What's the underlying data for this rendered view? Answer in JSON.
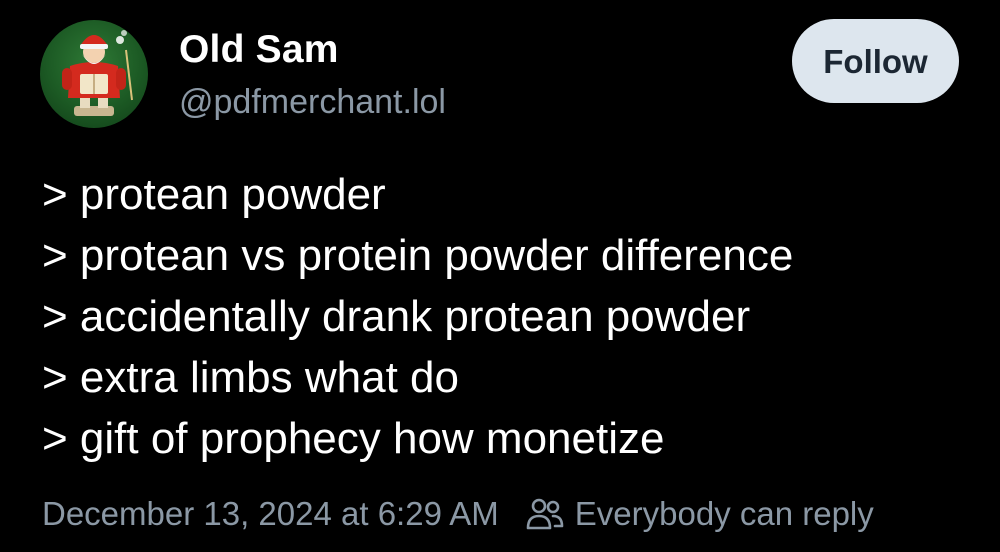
{
  "author": {
    "display_name": "Old Sam",
    "handle": "@pdfmerchant.lol",
    "avatar_icon": "nutcracker-smoker-figure-avatar"
  },
  "follow_button": {
    "label": "Follow"
  },
  "post": {
    "lines": [
      "> protean powder",
      "> protean vs protein powder difference",
      "> accidentally drank protean powder",
      "> extra limbs what do",
      "> gift of prophecy how monetize"
    ]
  },
  "meta": {
    "timestamp": "December 13, 2024 at 6:29 AM",
    "reply_icon": "people-icon",
    "reply_setting": "Everybody can reply"
  },
  "colors": {
    "background": "#000000",
    "text_primary": "#ffffff",
    "text_secondary": "#8b98a5",
    "follow_button_bg": "#dde6ee",
    "follow_button_text": "#1c2733"
  }
}
